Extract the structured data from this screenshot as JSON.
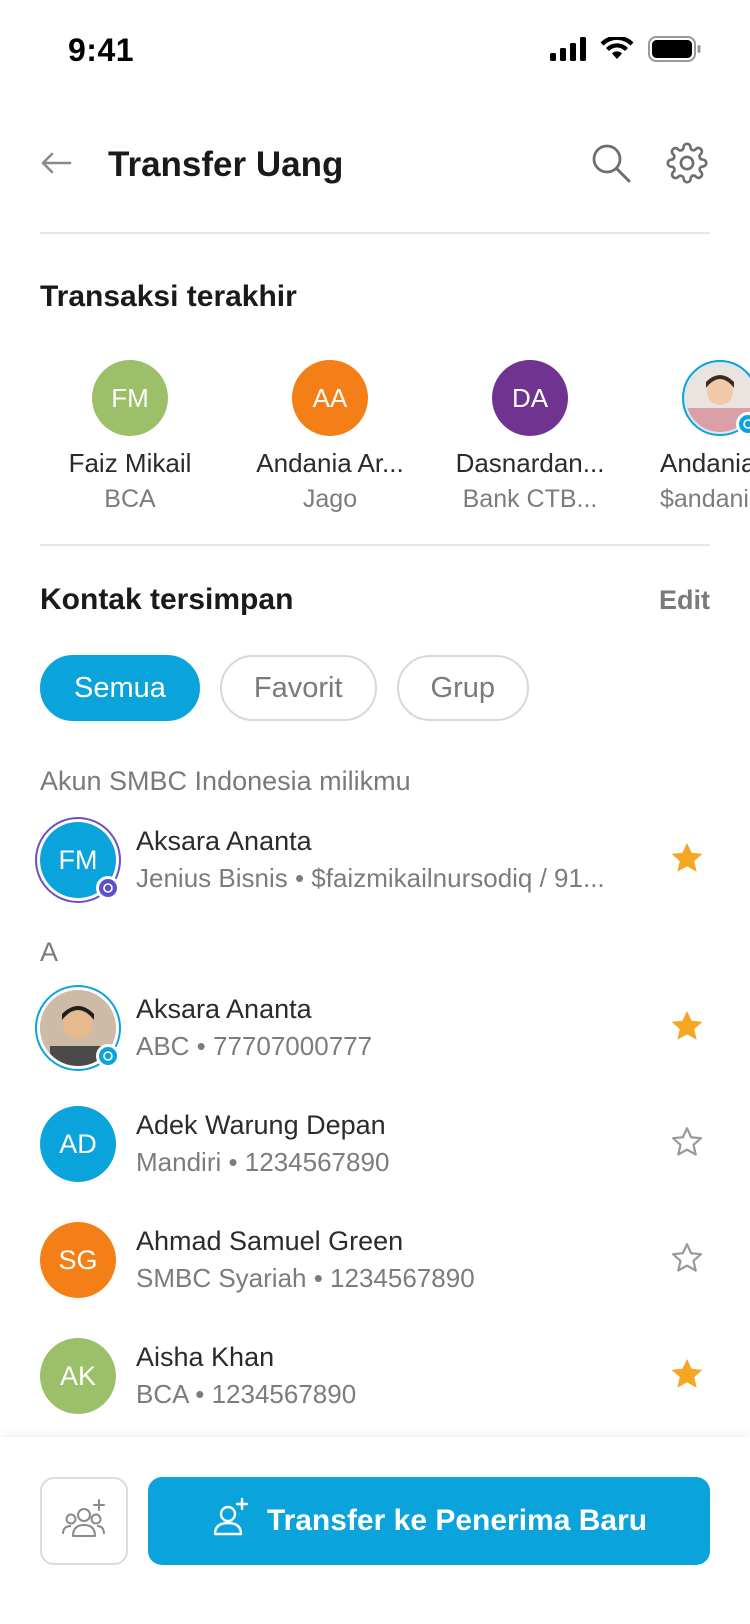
{
  "status_bar": {
    "time": "9:41"
  },
  "header": {
    "title": "Transfer Uang"
  },
  "recent": {
    "title": "Transaksi terakhir",
    "items": [
      {
        "initials": "FM",
        "name": "Faiz Mikail",
        "sub": "BCA",
        "color": "#9cc06a"
      },
      {
        "initials": "AA",
        "name": "Andania Ar...",
        "sub": "Jago",
        "color": "#f57f17"
      },
      {
        "initials": "DA",
        "name": "Dasnardan...",
        "sub": "Bank CTB...",
        "color": "#6f3390"
      },
      {
        "initials": "",
        "name": "Andania A",
        "sub": "$andania",
        "color": "#cfd8dc"
      }
    ]
  },
  "saved": {
    "title": "Kontak tersimpan",
    "edit_label": "Edit",
    "filters": [
      "Semua",
      "Favorit",
      "Grup"
    ],
    "own_account_label": "Akun SMBC Indonesia milikmu",
    "own_account": {
      "initials": "FM",
      "name": "Aksara Ananta",
      "sub": "Jenius Bisnis • $faizmikailnursodiq / 91...",
      "favorite": true,
      "color": "#0aa3dc"
    },
    "section_letter": "A",
    "contacts": [
      {
        "initials": "",
        "name": "Aksara Ananta",
        "sub": "ABC • 77707000777",
        "favorite": true,
        "color": "#d7c3ae"
      },
      {
        "initials": "AD",
        "name": "Adek Warung Depan",
        "sub": "Mandiri • 1234567890",
        "favorite": false,
        "color": "#0aa3dc"
      },
      {
        "initials": "SG",
        "name": "Ahmad Samuel Green",
        "sub": "SMBC Syariah • 1234567890",
        "favorite": false,
        "color": "#f57f17"
      },
      {
        "initials": "AK",
        "name": "Aisha Khan",
        "sub": "BCA • 1234567890",
        "favorite": true,
        "color": "#9cc06a"
      }
    ]
  },
  "bottom": {
    "primary_label": "Transfer ke Penerima Baru"
  },
  "colors": {
    "accent": "#0aa3dc",
    "star": "#f5a623",
    "muted": "#7a7a7a"
  }
}
